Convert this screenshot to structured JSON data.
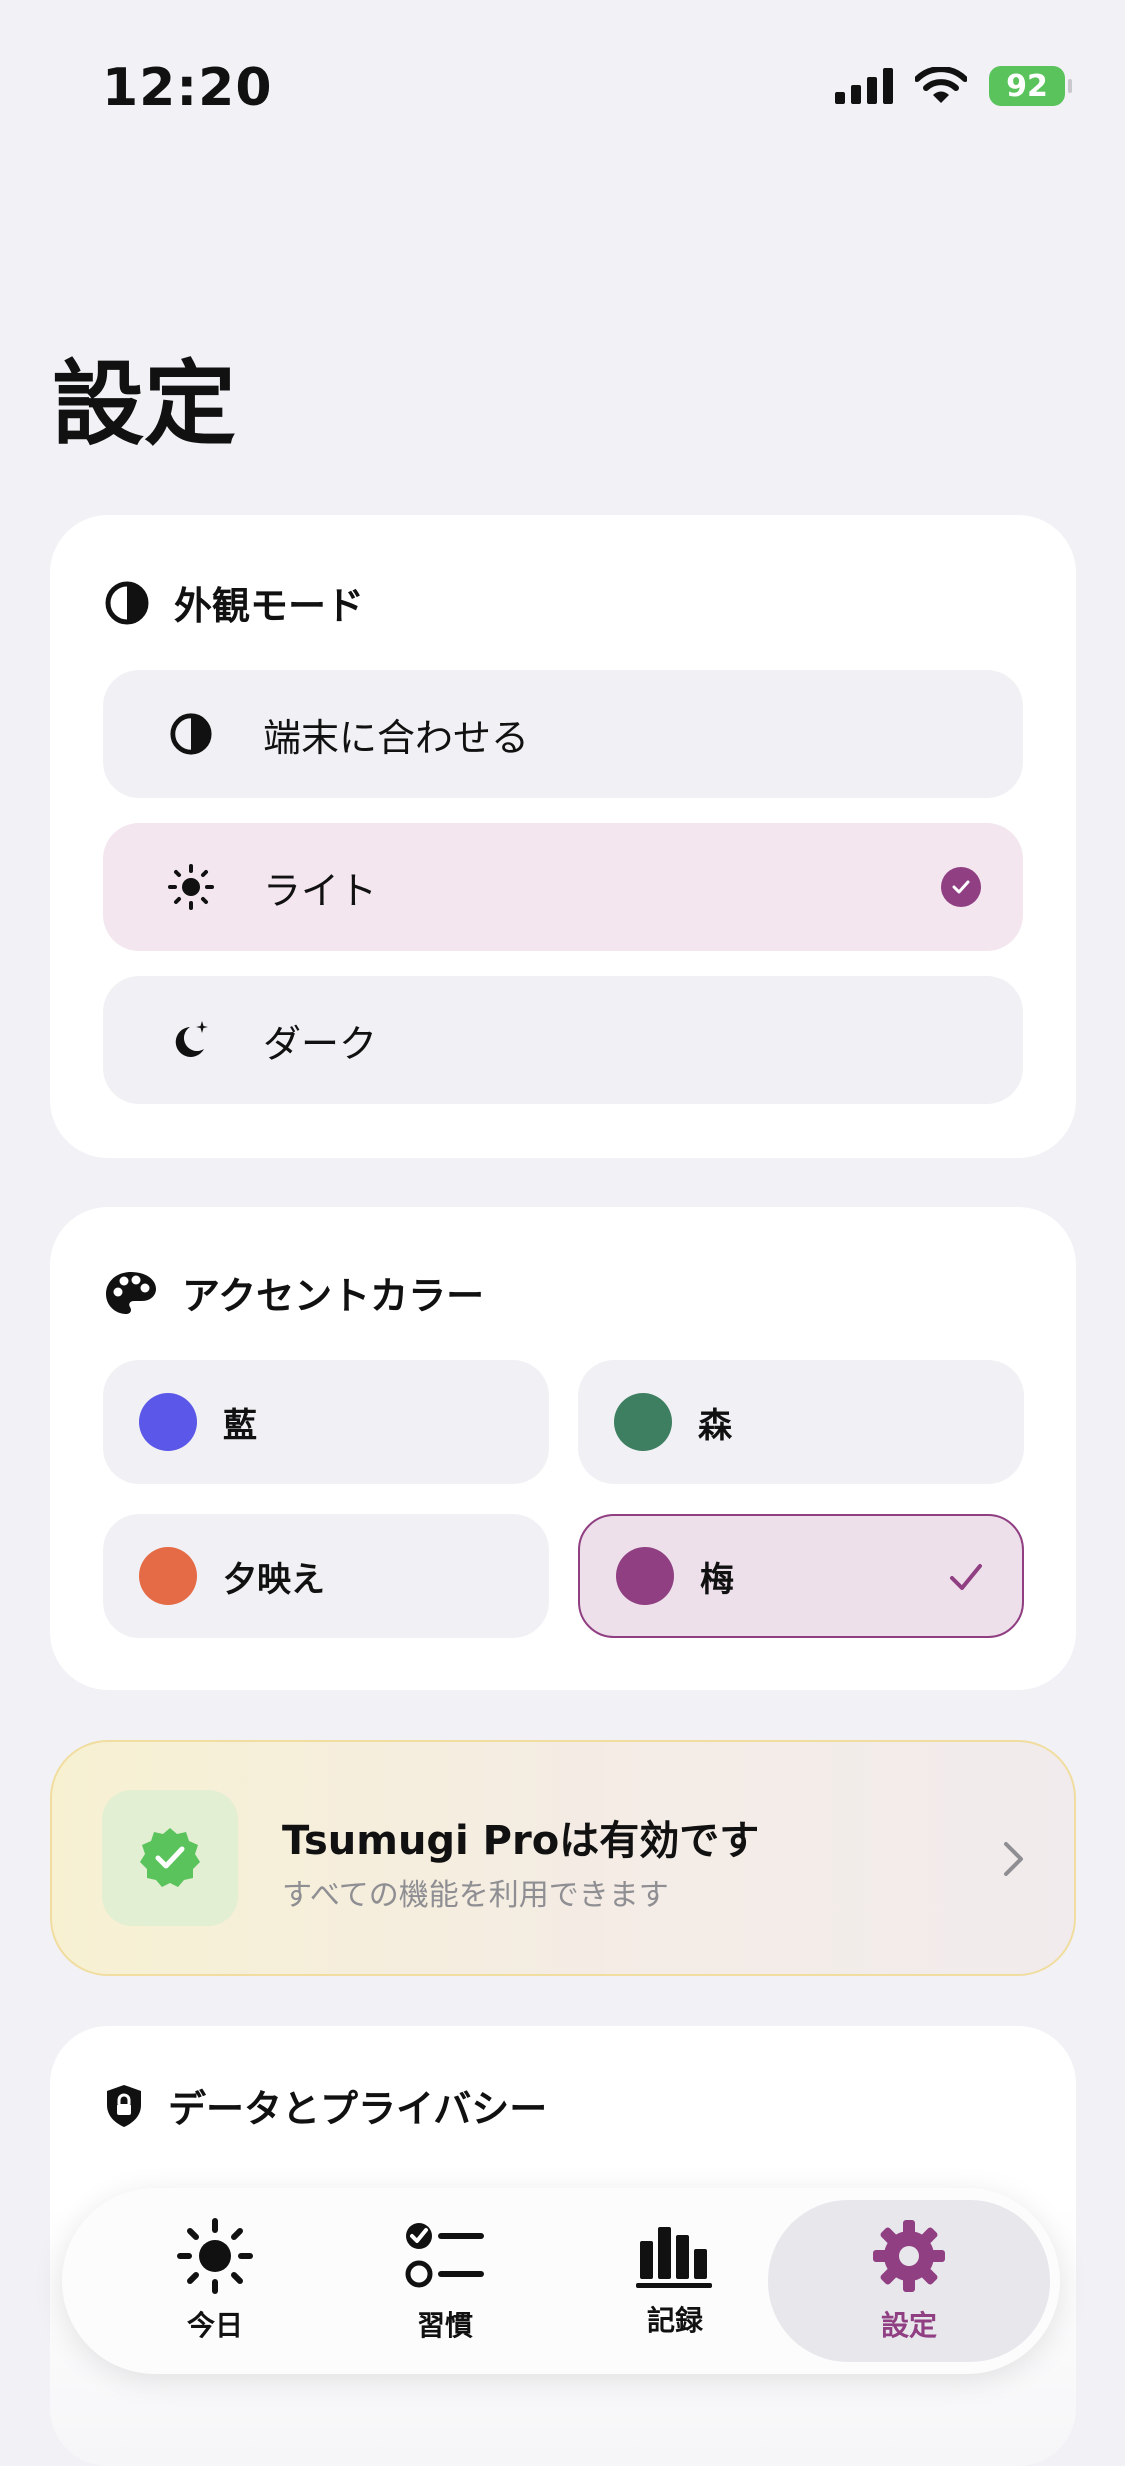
{
  "status": {
    "time": "12:20",
    "battery": "92"
  },
  "page": {
    "title": "設定"
  },
  "appearance": {
    "header": "外観モード",
    "options": [
      {
        "label": "端末に合わせる",
        "icon": "half-circle-icon",
        "selected": false
      },
      {
        "label": "ライト",
        "icon": "sun-icon",
        "selected": true
      },
      {
        "label": "ダーク",
        "icon": "moon-stars-icon",
        "selected": false
      }
    ]
  },
  "accent": {
    "header": "アクセントカラー",
    "options": [
      {
        "label": "藍",
        "color": "#5b57e8",
        "selected": false
      },
      {
        "label": "森",
        "color": "#3f7f61",
        "selected": false
      },
      {
        "label": "夕映え",
        "color": "#e56a46",
        "selected": false
      },
      {
        "label": "梅",
        "color": "#8f3f82",
        "selected": true
      }
    ]
  },
  "pro": {
    "title": "Tsumugi Proは有効です",
    "subtitle": "すべての機能を利用できます"
  },
  "privacy": {
    "header": "データとプライバシー"
  },
  "tabbar": {
    "tabs": [
      {
        "label": "今日",
        "icon": "sun-icon",
        "active": false
      },
      {
        "label": "習慣",
        "icon": "checklist-icon",
        "active": false
      },
      {
        "label": "記録",
        "icon": "bar-chart-icon",
        "active": false
      },
      {
        "label": "設定",
        "icon": "gear-icon",
        "active": true
      }
    ]
  },
  "colors": {
    "accent": "#8f3f82",
    "background": "#f2f1f6",
    "pro_badge": "#5ac35c"
  }
}
